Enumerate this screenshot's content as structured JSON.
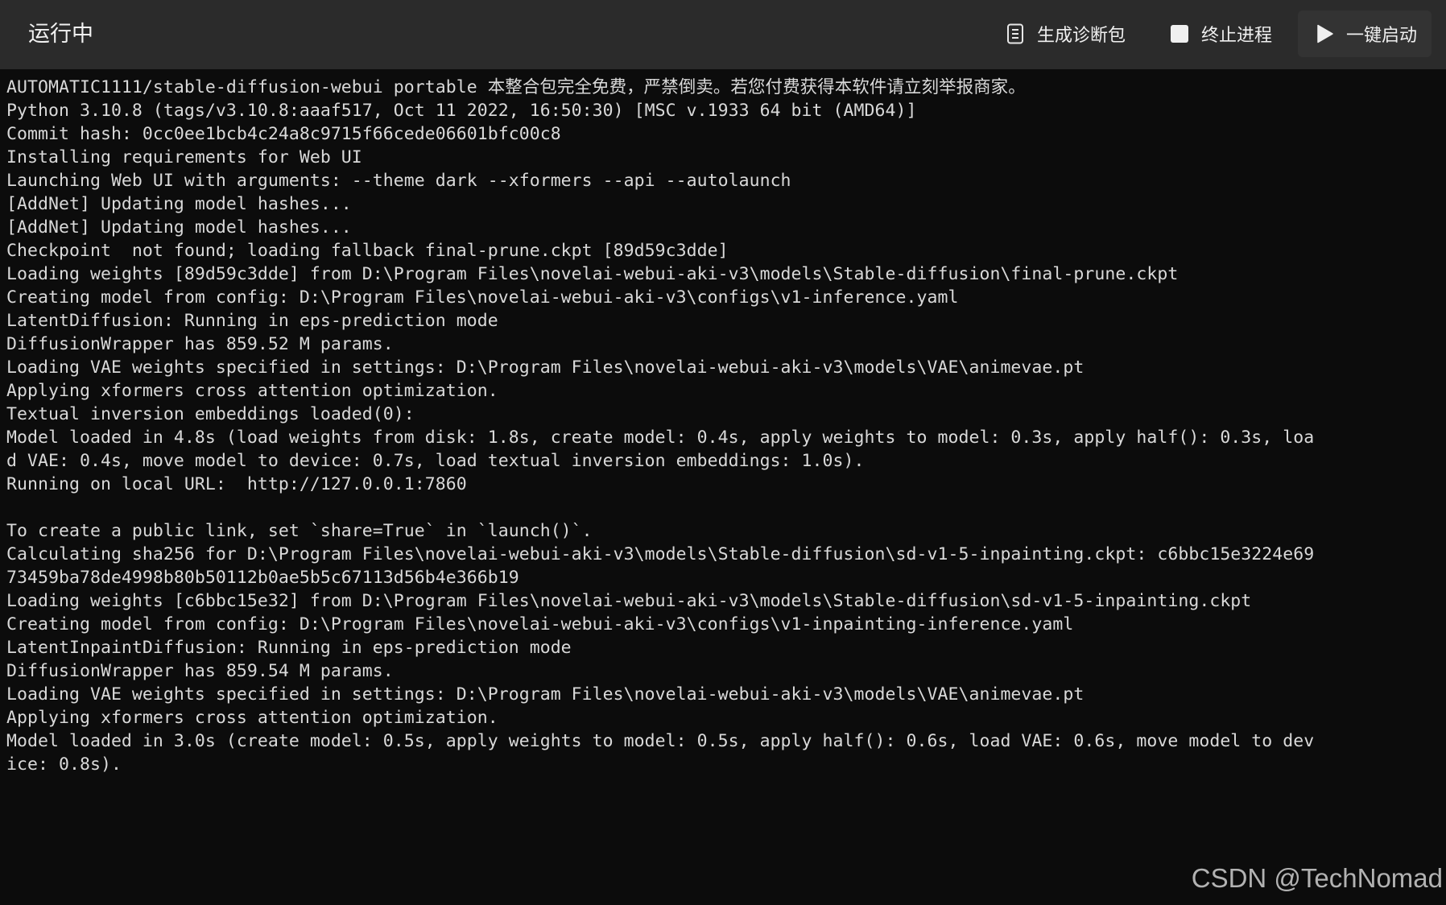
{
  "header": {
    "status": "运行中",
    "buttons": [
      {
        "label": "生成诊断包",
        "icon": "document-icon"
      },
      {
        "label": "终止进程",
        "icon": "stop-icon"
      },
      {
        "label": "一键启动",
        "icon": "play-icon"
      }
    ]
  },
  "console": {
    "lines": [
      "AUTOMATIC1111/stable-diffusion-webui portable 本整合包完全免费，严禁倒卖。若您付费获得本软件请立刻举报商家。",
      "Python 3.10.8 (tags/v3.10.8:aaaf517, Oct 11 2022, 16:50:30) [MSC v.1933 64 bit (AMD64)]",
      "Commit hash: 0cc0ee1bcb4c24a8c9715f66cede06601bfc00c8",
      "Installing requirements for Web UI",
      "Launching Web UI with arguments: --theme dark --xformers --api --autolaunch",
      "[AddNet] Updating model hashes...",
      "[AddNet] Updating model hashes...",
      "Checkpoint  not found; loading fallback final-prune.ckpt [89d59c3dde]",
      "Loading weights [89d59c3dde] from D:\\Program Files\\novelai-webui-aki-v3\\models\\Stable-diffusion\\final-prune.ckpt",
      "Creating model from config: D:\\Program Files\\novelai-webui-aki-v3\\configs\\v1-inference.yaml",
      "LatentDiffusion: Running in eps-prediction mode",
      "DiffusionWrapper has 859.52 M params.",
      "Loading VAE weights specified in settings: D:\\Program Files\\novelai-webui-aki-v3\\models\\VAE\\animevae.pt",
      "Applying xformers cross attention optimization.",
      "Textual inversion embeddings loaded(0):",
      "Model loaded in 4.8s (load weights from disk: 1.8s, create model: 0.4s, apply weights to model: 0.3s, apply half(): 0.3s, loa",
      "d VAE: 0.4s, move model to device: 0.7s, load textual inversion embeddings: 1.0s).",
      "Running on local URL:  http://127.0.0.1:7860",
      "",
      "To create a public link, set `share=True` in `launch()`.",
      "Calculating sha256 for D:\\Program Files\\novelai-webui-aki-v3\\models\\Stable-diffusion\\sd-v1-5-inpainting.ckpt: c6bbc15e3224e69",
      "73459ba78de4998b80b50112b0ae5b5c67113d56b4e366b19",
      "Loading weights [c6bbc15e32] from D:\\Program Files\\novelai-webui-aki-v3\\models\\Stable-diffusion\\sd-v1-5-inpainting.ckpt",
      "Creating model from config: D:\\Program Files\\novelai-webui-aki-v3\\configs\\v1-inpainting-inference.yaml",
      "LatentInpaintDiffusion: Running in eps-prediction mode",
      "DiffusionWrapper has 859.54 M params.",
      "Loading VAE weights specified in settings: D:\\Program Files\\novelai-webui-aki-v3\\models\\VAE\\animevae.pt",
      "Applying xformers cross attention optimization.",
      "Model loaded in 3.0s (create model: 0.5s, apply weights to model: 0.5s, apply half(): 0.6s, load VAE: 0.6s, move model to dev",
      "ice: 0.8s)."
    ]
  },
  "watermark": "CSDN @TechNomad"
}
